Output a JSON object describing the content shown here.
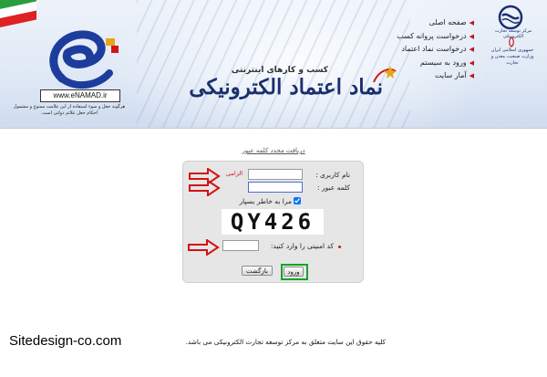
{
  "header": {
    "title_main": "نماد اعتماد الکترونیکی",
    "title_sub": "کسب و کارهای اینترنتی",
    "enamad_text": "www.eNAMAD.ir",
    "enamad_warning": "هرگونه جعل و سوء استفاده از این علامت ممنوع و مشمول احکام جعل علائم دولتی است.",
    "emblem_caption": "مرکز توسعه تجارت الکترونیکی",
    "ministry_caption": "جمهوری اسلامی ایران وزارت صنعت، معدن و تجارت"
  },
  "nav": {
    "items": [
      "صفحه اصلی",
      "درخواست پروانه کسب",
      "درخواست نماد اعتماد",
      "ورود به سیستم",
      "آمار سایت"
    ]
  },
  "login": {
    "recover_link": "دریافت مجدد کلمه عبور",
    "username_label": "نام کاربری :",
    "username_required": "الزامی",
    "password_label": "کلمه عبور :",
    "remember_label": "مرا به خاطر بسپار",
    "captcha_text": "QY426",
    "captcha_label": "کد امنیتی را وارد کنید:",
    "back_button": "بازگشت",
    "login_button": "ورود"
  },
  "footer": {
    "site_watermark": "Sitedesign-co.com",
    "copyright": "کلیه حقوق این سایت متعلق به مرکز توسعه تجارت الکترونیکی می باشد."
  },
  "colors": {
    "accent_red": "#d21414",
    "highlight_green": "#16a32a",
    "brand_blue": "#1a2f6e"
  },
  "icons": {
    "flag": "iran-flag-icon",
    "enamad": "enamad-logo-icon",
    "emblem": "ecommerce-emblem-icon",
    "arrow": "red-arrow-annotation-icon"
  }
}
